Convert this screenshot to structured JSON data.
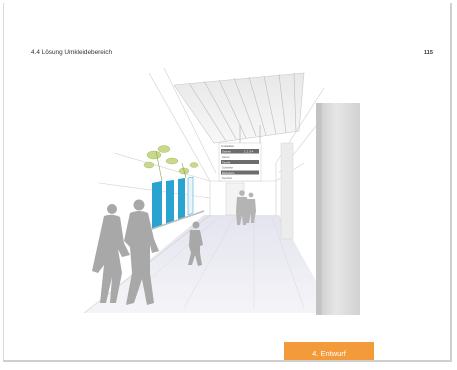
{
  "header": {
    "section_title": "4.4 Lösung Umkleidebereich",
    "page_number": "115"
  },
  "footer": {
    "chapter_tab": "4. Entwurf"
  },
  "sign": {
    "top_label": "Umkleiden",
    "rows": [
      {
        "label": "Damen",
        "value": "1 2 3 4"
      },
      {
        "label": "Herren",
        "value": ""
      },
      {
        "label": "Familie",
        "value": ""
      },
      {
        "label": "Schränke",
        "value": ""
      },
      {
        "label": "Behinderte",
        "value": ""
      },
      {
        "label": "Duschen",
        "value": ""
      }
    ]
  },
  "colors": {
    "accent_orange": "#f39b3a",
    "locker_blue": "#2aa3d0",
    "figure_grey": "#a8a8a8"
  }
}
